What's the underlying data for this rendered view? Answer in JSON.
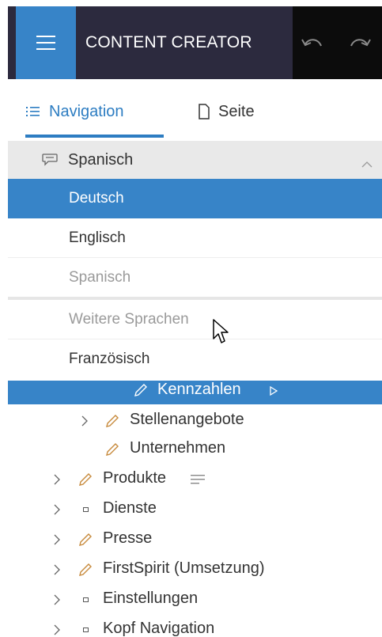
{
  "header": {
    "app_title": "CONTENT CREATOR",
    "menu_icon": "hamburger-icon",
    "undo_icon": "undo-icon",
    "redo_icon": "redo-icon"
  },
  "tabs": [
    {
      "label": "Navigation",
      "icon": "list-icon",
      "active": true
    },
    {
      "label": "Seite",
      "icon": "page-icon",
      "active": false
    }
  ],
  "language_dropdown": {
    "selected": "Spanisch",
    "icon": "speech-bubble-icon",
    "options": [
      {
        "label": "Deutsch",
        "state": "highlighted"
      },
      {
        "label": "Englisch",
        "state": "normal"
      },
      {
        "label": "Spanisch",
        "state": "disabled"
      }
    ],
    "more_label": "Weitere Sprachen",
    "more_options": [
      {
        "label": "Französisch",
        "state": "normal"
      }
    ]
  },
  "tree": {
    "selected_item": {
      "label": "Kennzahlen",
      "icon": "pencil-icon"
    },
    "items": [
      {
        "label": "Stellenangebote",
        "icon": "pencil-icon",
        "expandable": true
      },
      {
        "label": "Unternehmen",
        "icon": "pencil-icon",
        "expandable": false
      },
      {
        "label": "Produkte",
        "icon": "pencil-icon",
        "expandable": true,
        "extra_icon": "lines-icon"
      },
      {
        "label": "Dienste",
        "icon": "square-icon",
        "expandable": true
      },
      {
        "label": "Presse",
        "icon": "pencil-icon",
        "expandable": true
      },
      {
        "label": "FirstSpirit (Umsetzung)",
        "icon": "pencil-icon",
        "expandable": true
      },
      {
        "label": "Einstellungen",
        "icon": "square-icon",
        "expandable": true
      },
      {
        "label": "Kopf Navigation",
        "icon": "square-icon",
        "expandable": true
      }
    ]
  },
  "colors": {
    "header_bg": "#2c2a3e",
    "accent": "#3784c8",
    "pencil": "#c78a3c"
  }
}
